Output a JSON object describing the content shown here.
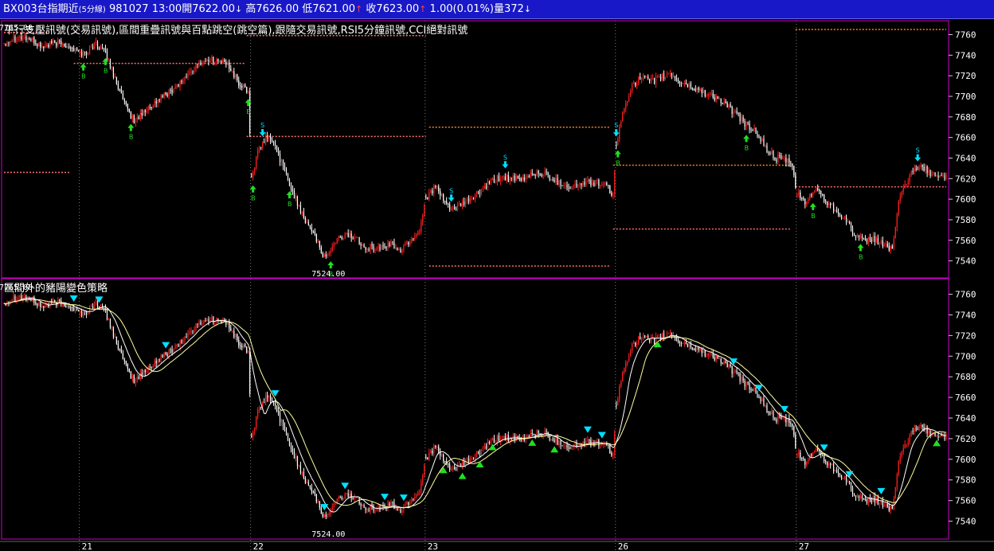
{
  "header": {
    "symbol": "BX003台指期近",
    "interval": "(5分線)",
    "date": "981027",
    "time": "13:00",
    "open_label": "開",
    "open": "7622.00",
    "high_label": "高",
    "high": "7626.00",
    "low_label": "低",
    "low": "7621.00",
    "close_label": "收",
    "close": "7623.00",
    "change": "1.00",
    "change_pct": "(0.01%)",
    "volume_label": "量",
    "volume": "372"
  },
  "colors": {
    "titlebar_bg": "#1818c8",
    "panel_border": "#c800c8",
    "up_candle": "#ff2020",
    "down_candle": "#ffffff",
    "ma_fast": "#ffffff",
    "ma_slow": "#ffffa0",
    "buy_signal": "#20e020",
    "sell_signal": "#00e0ff",
    "support_line": "#ff7070",
    "resistance_line": "#ff8020"
  },
  "chart_data": {
    "type": "candlestick",
    "x_labels": [
      "21",
      "22",
      "23",
      "26",
      "27"
    ],
    "y_ticks": [
      7540,
      7560,
      7580,
      7600,
      7620,
      7640,
      7660,
      7680,
      7700,
      7720,
      7740,
      7760
    ],
    "ylim": [
      7525,
      7772
    ],
    "anchors": [
      [
        0,
        7752
      ],
      [
        8,
        7758
      ],
      [
        16,
        7756
      ],
      [
        24,
        7748
      ],
      [
        32,
        7752
      ],
      [
        40,
        7750
      ],
      [
        48,
        7742
      ],
      [
        52,
        7742
      ],
      [
        58,
        7752
      ],
      [
        64,
        7742
      ],
      [
        70,
        7718
      ],
      [
        76,
        7692
      ],
      [
        82,
        7676
      ],
      [
        88,
        7684
      ],
      [
        95,
        7694
      ],
      [
        102,
        7702
      ],
      [
        110,
        7712
      ],
      [
        118,
        7724
      ],
      [
        124,
        7733
      ],
      [
        130,
        7736
      ],
      [
        136,
        7734
      ],
      [
        142,
        7730
      ],
      [
        148,
        7712
      ],
      [
        154,
        7705
      ],
      [
        156,
        7622
      ],
      [
        160,
        7645
      ],
      [
        166,
        7662
      ],
      [
        172,
        7648
      ],
      [
        178,
        7622
      ],
      [
        184,
        7600
      ],
      [
        190,
        7580
      ],
      [
        196,
        7566
      ],
      [
        200,
        7546
      ],
      [
        204,
        7545
      ],
      [
        210,
        7560
      ],
      [
        216,
        7566
      ],
      [
        222,
        7562
      ],
      [
        228,
        7554
      ],
      [
        236,
        7552
      ],
      [
        244,
        7556
      ],
      [
        250,
        7550
      ],
      [
        256,
        7560
      ],
      [
        262,
        7570
      ],
      [
        266,
        7602
      ],
      [
        272,
        7612
      ],
      [
        278,
        7596
      ],
      [
        284,
        7590
      ],
      [
        290,
        7596
      ],
      [
        296,
        7602
      ],
      [
        302,
        7610
      ],
      [
        308,
        7617
      ],
      [
        314,
        7622
      ],
      [
        320,
        7620
      ],
      [
        326,
        7618
      ],
      [
        334,
        7626
      ],
      [
        342,
        7624
      ],
      [
        350,
        7616
      ],
      [
        358,
        7612
      ],
      [
        366,
        7616
      ],
      [
        374,
        7616
      ],
      [
        380,
        7612
      ],
      [
        384,
        7605
      ],
      [
        386,
        7650
      ],
      [
        390,
        7684
      ],
      [
        396,
        7712
      ],
      [
        402,
        7718
      ],
      [
        408,
        7714
      ],
      [
        414,
        7718
      ],
      [
        420,
        7722
      ],
      [
        426,
        7714
      ],
      [
        432,
        7710
      ],
      [
        438,
        7706
      ],
      [
        444,
        7702
      ],
      [
        450,
        7698
      ],
      [
        456,
        7690
      ],
      [
        462,
        7682
      ],
      [
        468,
        7672
      ],
      [
        474,
        7666
      ],
      [
        480,
        7650
      ],
      [
        486,
        7640
      ],
      [
        496,
        7636
      ],
      [
        500,
        7606
      ],
      [
        506,
        7596
      ],
      [
        512,
        7612
      ],
      [
        518,
        7598
      ],
      [
        524,
        7590
      ],
      [
        530,
        7582
      ],
      [
        536,
        7566
      ],
      [
        542,
        7558
      ],
      [
        548,
        7562
      ],
      [
        554,
        7556
      ],
      [
        560,
        7552
      ],
      [
        564,
        7596
      ],
      [
        570,
        7620
      ],
      [
        576,
        7632
      ],
      [
        582,
        7628
      ],
      [
        588,
        7622
      ],
      [
        594,
        7622
      ]
    ],
    "session_starts": [
      48,
      156,
      266,
      386,
      500
    ],
    "panels": [
      {
        "title": "平行支壓訊號(交易訊號),區間重疊訊號與百點跳空(跳空篇),跟隨交易訊號,RSI5分鐘訊號,CCI絕對訊號",
        "high_note": "7765.00",
        "low_note": "7524.00",
        "signals": [
          {
            "i": 50,
            "type": "B"
          },
          {
            "i": 64,
            "type": "B"
          },
          {
            "i": 80,
            "type": "B"
          },
          {
            "i": 154,
            "type": "B"
          },
          {
            "i": 157,
            "type": "B"
          },
          {
            "i": 180,
            "type": "B"
          },
          {
            "i": 206,
            "type": "B"
          },
          {
            "i": 163,
            "type": "S"
          },
          {
            "i": 282,
            "type": "S"
          },
          {
            "i": 316,
            "type": "S"
          },
          {
            "i": 386,
            "type": "S"
          },
          {
            "i": 387,
            "type": "B"
          },
          {
            "i": 468,
            "type": "B"
          },
          {
            "i": 510,
            "type": "B"
          },
          {
            "i": 540,
            "type": "B"
          },
          {
            "i": 576,
            "type": "S"
          }
        ],
        "levels": [
          {
            "value": 7762,
            "from": 0,
            "to": 28,
            "color": "#ff7070"
          },
          {
            "value": 7626,
            "from": 0,
            "to": 42,
            "color": "#ff7070"
          },
          {
            "value": 7732,
            "from": 44,
            "to": 152,
            "color": "#ff7070"
          },
          {
            "value": 7759,
            "from": 153,
            "to": 266,
            "color": "#ff7070"
          },
          {
            "value": 7661,
            "from": 153,
            "to": 266,
            "color": "#ff7070"
          },
          {
            "value": 7670,
            "from": 268,
            "to": 382,
            "color": "#ff8020"
          },
          {
            "value": 7535,
            "from": 268,
            "to": 382,
            "color": "#ff7070"
          },
          {
            "value": 7633,
            "from": 384,
            "to": 496,
            "color": "#ff8020"
          },
          {
            "value": 7571,
            "from": 384,
            "to": 496,
            "color": "#ff7070"
          },
          {
            "value": 7765,
            "from": 499,
            "to": 594,
            "color": "#ff8020"
          },
          {
            "value": 7612,
            "from": 499,
            "to": 594,
            "color": "#ff7070"
          }
        ]
      },
      {
        "title": "區間外的豬陽變色策略",
        "high_note": "7765.00",
        "low_note": "7524.00",
        "triangles": [
          {
            "i": 44,
            "type": "down"
          },
          {
            "i": 60,
            "type": "down"
          },
          {
            "i": 102,
            "type": "down"
          },
          {
            "i": 171,
            "type": "down"
          },
          {
            "i": 202,
            "type": "down"
          },
          {
            "i": 215,
            "type": "down"
          },
          {
            "i": 240,
            "type": "down"
          },
          {
            "i": 252,
            "type": "down"
          },
          {
            "i": 368,
            "type": "down"
          },
          {
            "i": 377,
            "type": "down"
          },
          {
            "i": 460,
            "type": "down"
          },
          {
            "i": 476,
            "type": "down"
          },
          {
            "i": 492,
            "type": "down"
          },
          {
            "i": 517,
            "type": "down"
          },
          {
            "i": 533,
            "type": "down"
          },
          {
            "i": 553,
            "type": "down"
          },
          {
            "i": 277,
            "type": "up"
          },
          {
            "i": 289,
            "type": "up"
          },
          {
            "i": 300,
            "type": "up"
          },
          {
            "i": 308,
            "type": "up"
          },
          {
            "i": 333,
            "type": "up"
          },
          {
            "i": 347,
            "type": "up"
          },
          {
            "i": 412,
            "type": "up"
          },
          {
            "i": 588,
            "type": "up"
          }
        ]
      }
    ]
  }
}
